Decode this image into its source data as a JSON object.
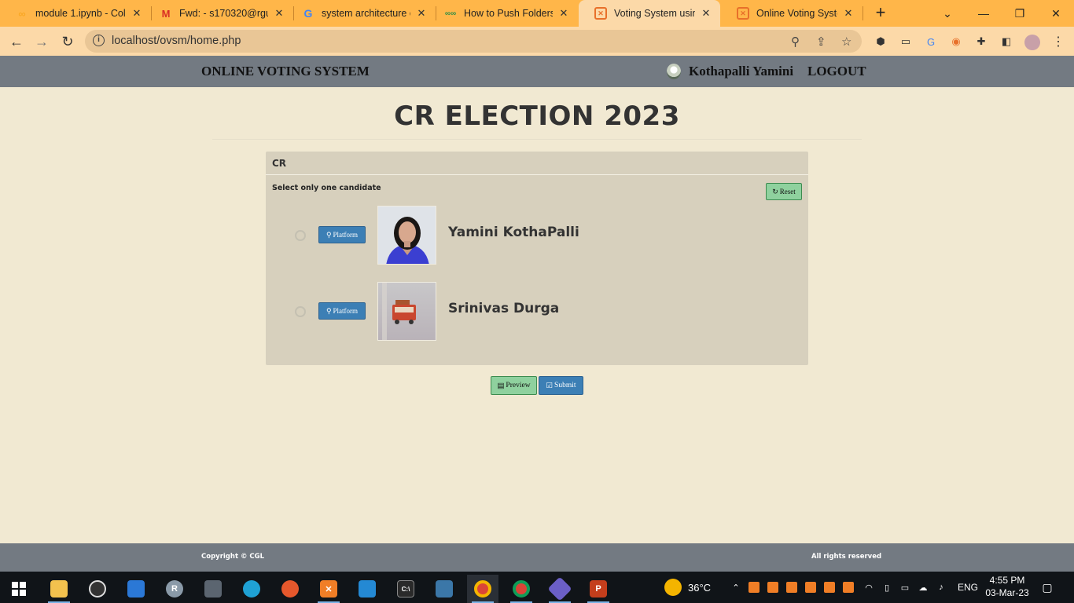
{
  "browser": {
    "tabs": [
      {
        "title": "module 1.ipynb - Cola",
        "icon": "colab-icon"
      },
      {
        "title": "Fwd: - s170320@rguk",
        "icon": "gmail-icon"
      },
      {
        "title": "system architecture of",
        "icon": "google-icon"
      },
      {
        "title": "How to Push Folders F",
        "icon": "geeksforgeeks-icon"
      },
      {
        "title": "Voting System using P",
        "icon": "xampp-icon"
      },
      {
        "title": "Online Voting System",
        "icon": "xampp-icon"
      }
    ],
    "active_tab_index": 4,
    "url": "localhost/ovsm/home.php"
  },
  "header": {
    "brand": "ONLINE VOTING SYSTEM",
    "user_name": "Kothapalli Yamini",
    "logout_label": "LOGOUT"
  },
  "election": {
    "title": "CR ELECTION 2023",
    "position": {
      "name": "CR",
      "instruction": "Select only one candidate",
      "reset_label": "Reset",
      "candidates": [
        {
          "name": "Yamini KothaPalli",
          "platform_label": "Platform",
          "selected": false
        },
        {
          "name": "Srinivas Durga",
          "platform_label": "Platform",
          "selected": false
        }
      ]
    },
    "preview_label": "Preview",
    "submit_label": "Submit"
  },
  "footer": {
    "left": "Copyright © CGL",
    "right": "All rights reserved"
  },
  "taskbar": {
    "weather": "36°C",
    "language": "ENG",
    "time": "4:55 PM",
    "date": "03-Mar-23"
  },
  "colors": {
    "tab_strip": "#ffb649",
    "page_bg": "#f1e9d2",
    "header_bg": "#737a82",
    "panel_bg": "#d7d0bd",
    "success": "#8fd19e",
    "primary": "#3c7fb5"
  }
}
